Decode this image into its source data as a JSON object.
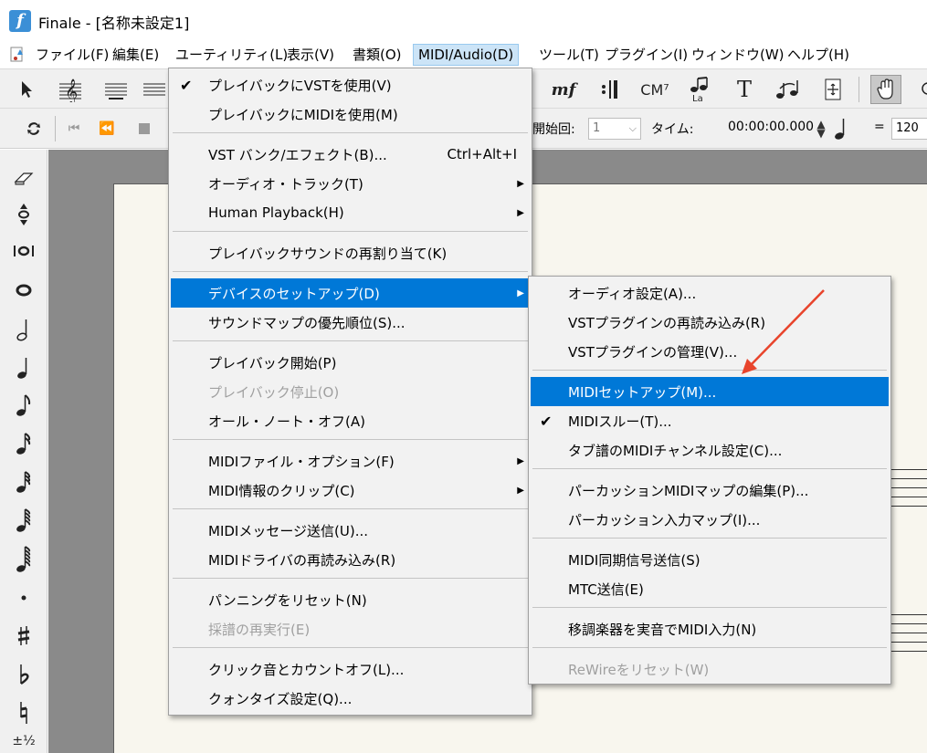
{
  "window": {
    "app_logo_letter": "f",
    "title": "Finale - [名称未設定1]"
  },
  "menubar": {
    "items": [
      {
        "label": "ファイル(F)"
      },
      {
        "label": "編集(E)"
      },
      {
        "label": "ユーティリティ(L)"
      },
      {
        "label": "表示(V)"
      },
      {
        "label": "書類(O)"
      },
      {
        "label": "MIDI/Audio(D)",
        "active": true
      },
      {
        "label": "ツール(T)"
      },
      {
        "label": "プラグイン(I)"
      },
      {
        "label": "ウィンドウ(W)"
      },
      {
        "label": "ヘルプ(H)"
      }
    ]
  },
  "toolbar": {
    "chord_tool": "CM⁷",
    "lyrics_tool": "La",
    "text_tool": "T",
    "dynamics_tool": "mf"
  },
  "playback": {
    "start_label": "開始回:",
    "start_value": "1",
    "time_label": "タイム:",
    "time_value": "00:00:00.000",
    "equals": "=",
    "tempo_value": "120"
  },
  "palette": {
    "items": [
      "eraser-icon",
      "half-step-icon",
      "tuplet-icon",
      "whole-note-icon",
      "half-note-icon",
      "quarter-note-icon",
      "eighth-note-icon",
      "sixteenth-note-icon",
      "32nd-note-icon",
      "64th-note-icon",
      "128th-note-icon",
      "dot-icon",
      "sharp-icon",
      "flat-icon",
      "natural-icon"
    ],
    "partial_label": "±½"
  },
  "midi_menu": {
    "items": [
      {
        "label": "プレイバックにVSTを使用(V)",
        "checked": true
      },
      {
        "label": "プレイバックにMIDIを使用(M)"
      },
      {
        "label": "VST バンク/エフェクト(B)...",
        "shortcut": "Ctrl+Alt+I"
      },
      {
        "label": "オーディオ・トラック(T)",
        "submenu": true
      },
      {
        "label": "Human Playback(H)",
        "submenu": true
      },
      {
        "label": "プレイバックサウンドの再割り当て(K)"
      },
      {
        "label": "デバイスのセットアップ(D)",
        "submenu": true,
        "highlighted": true
      },
      {
        "label": "サウンドマップの優先順位(S)..."
      },
      {
        "label": "プレイバック開始(P)"
      },
      {
        "label": "プレイバック停止(O)",
        "disabled": true
      },
      {
        "label": "オール・ノート・オフ(A)"
      },
      {
        "label": "MIDIファイル・オプション(F)",
        "submenu": true
      },
      {
        "label": "MIDI情報のクリップ(C)",
        "submenu": true
      },
      {
        "label": "MIDIメッセージ送信(U)..."
      },
      {
        "label": "MIDIドライバの再読み込み(R)"
      },
      {
        "label": "パンニングをリセット(N)"
      },
      {
        "label": "採譜の再実行(E)",
        "disabled": true
      },
      {
        "label": "クリック音とカウントオフ(L)..."
      },
      {
        "label": "クォンタイズ設定(Q)..."
      }
    ]
  },
  "device_submenu": {
    "items": [
      {
        "label": "オーディオ設定(A)..."
      },
      {
        "label": "VSTプラグインの再読み込み(R)"
      },
      {
        "label": "VSTプラグインの管理(V)..."
      },
      {
        "label": "MIDIセットアップ(M)...",
        "highlighted": true
      },
      {
        "label": "MIDIスルー(T)...",
        "checked": true
      },
      {
        "label": "タブ譜のMIDIチャンネル設定(C)..."
      },
      {
        "label": "パーカッションMIDIマップの編集(P)..."
      },
      {
        "label": "パーカッション入力マップ(I)..."
      },
      {
        "label": "MIDI同期信号送信(S)"
      },
      {
        "label": "MTC送信(E)"
      },
      {
        "label": "移調楽器を実音でMIDI入力(N)"
      },
      {
        "label": "ReWireをリセット(W)",
        "disabled": true
      }
    ]
  },
  "glyphs": {
    "check": "✔",
    "submenu_arrow": "▶"
  },
  "colors": {
    "menu_highlight": "#0078d7",
    "menubar_active": "#cce4f7",
    "annotation_arrow": "#e8442c",
    "paper": "#f8f6ee"
  }
}
